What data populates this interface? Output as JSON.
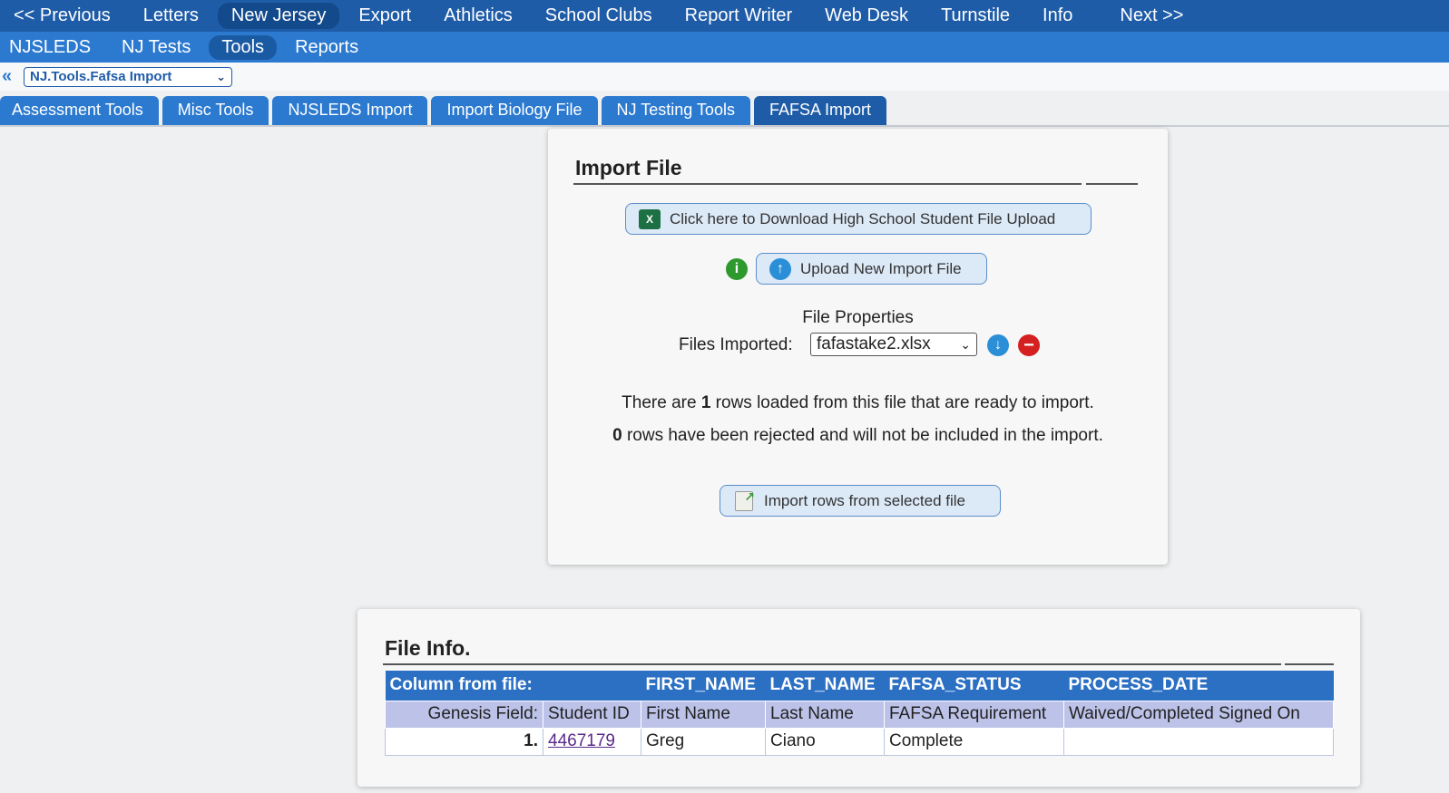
{
  "nav_main": {
    "items": [
      "<< Previous",
      "Letters",
      "New Jersey",
      "Export",
      "Athletics",
      "School Clubs",
      "Report Writer",
      "Web Desk",
      "Turnstile",
      "Info",
      "Next >>"
    ]
  },
  "nav_sub": {
    "items": [
      "NJSLEDS",
      "NJ Tests",
      "Tools",
      "Reports"
    ]
  },
  "crumb": {
    "back": "«",
    "selected": "NJ.Tools.Fafsa Import"
  },
  "tabs": [
    "Assessment Tools",
    "Misc Tools",
    "NJSLEDS Import",
    "Import Biology File",
    "NJ Testing Tools",
    "FAFSA Import"
  ],
  "import_panel": {
    "title": "Import File",
    "download_label": "Click here to Download High School Student File Upload",
    "upload_label": "Upload New Import File",
    "file_properties": "File Properties",
    "files_imported_label": "Files Imported:",
    "selected_file": "fafastake2.xlsx",
    "ready_pre": "There are ",
    "ready_count": "1",
    "ready_post": " rows loaded from this file that are ready to import.",
    "rejected_count": "0",
    "rejected_post": " rows have been rejected and will not be included in the import.",
    "import_label": "Import rows from selected file"
  },
  "file_info": {
    "title": "File Info.",
    "header": [
      "Column from file:",
      "",
      "FIRST_NAME",
      "LAST_NAME",
      "FAFSA_STATUS",
      "PROCESS_DATE"
    ],
    "genesis": [
      "Genesis Field:",
      "Student ID",
      "First Name",
      "Last Name",
      "FAFSA Requirement",
      "Waived/Completed Signed On"
    ],
    "rows": [
      {
        "num": "1.",
        "student_id": "4467179",
        "first": "Greg",
        "last": "Ciano",
        "status": "Complete",
        "date": ""
      }
    ]
  }
}
